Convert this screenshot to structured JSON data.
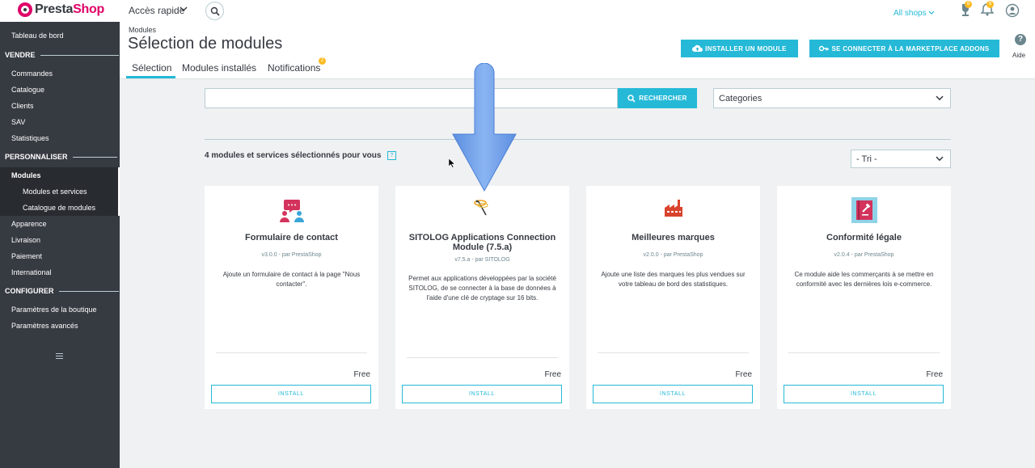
{
  "topbar": {
    "logo_text_pre": "Presta",
    "logo_text_post": "Shop",
    "quick_access": "Accès rapide",
    "shops": "All shops",
    "orders_badge": "6",
    "notif_badge": "8"
  },
  "sidebar": {
    "dashboard": "Tableau de bord",
    "sell": "VENDRE",
    "orders": "Commandes",
    "catalog": "Catalogue",
    "customers": "Clients",
    "service": "SAV",
    "stats": "Statistiques",
    "customize": "PERSONNALISER",
    "modules": "Modules",
    "modules_services": "Modules et services",
    "modules_catalog": "Catalogue de modules",
    "appearance": "Apparence",
    "shipping": "Livraison",
    "payment": "Paiement",
    "international": "International",
    "configure": "CONFIGURER",
    "shop_params": "Paramètres de la boutique",
    "adv_params": "Paramètres avancés"
  },
  "header": {
    "breadcrumb": "Modules",
    "title": "Sélection de modules",
    "tabs": [
      "Sélection",
      "Modules installés",
      "Notifications"
    ],
    "notif_count": "2",
    "install_module": "INSTALLER UN MODULE",
    "marketplace": "SE CONNECTER À LA MARKETPLACE ADDONS",
    "help": "Aide"
  },
  "search": {
    "placeholder": "",
    "button": "RECHERCHER",
    "categories": "Categories"
  },
  "listing": {
    "count_text": "4 modules et services sélectionnés pour vous",
    "sort": "- Tri -"
  },
  "cards": [
    {
      "name": "Formulaire de contact",
      "version": "v3.0.0 - par PrestaShop",
      "description": "Ajoute un formulaire de contact à la page \"Nous contacter\".",
      "price": "Free",
      "install": "INSTALL"
    },
    {
      "name": "SITOLOG Applications Connection Module (7.5.a)",
      "version": "v7.5.a - par SITOLOG",
      "description": "Permet aux applications développées par la société SITOLOG, de se connecter à la base de données à l'aide d'une clé de cryptage sur 16 bits.",
      "price": "Free",
      "install": "INSTALL"
    },
    {
      "name": "Meilleures marques",
      "version": "v2.0.0 - par PrestaShop",
      "description": "Ajoute une liste des marques les plus vendues sur votre tableau de bord des statistiques.",
      "price": "Free",
      "install": "INSTALL"
    },
    {
      "name": "Conformité légale",
      "version": "v2.0.4 - par PrestaShop",
      "description": "Ce module aide les commerçants à se mettre en conformité avec les dernières lois e-commerce.",
      "price": "Free",
      "install": "INSTALL"
    }
  ],
  "colors": {
    "accent": "#25b9d7",
    "sidebar": "#363a41",
    "brand": "#df0067",
    "badge": "#fbbb22",
    "arrow": "#6a9de8"
  }
}
